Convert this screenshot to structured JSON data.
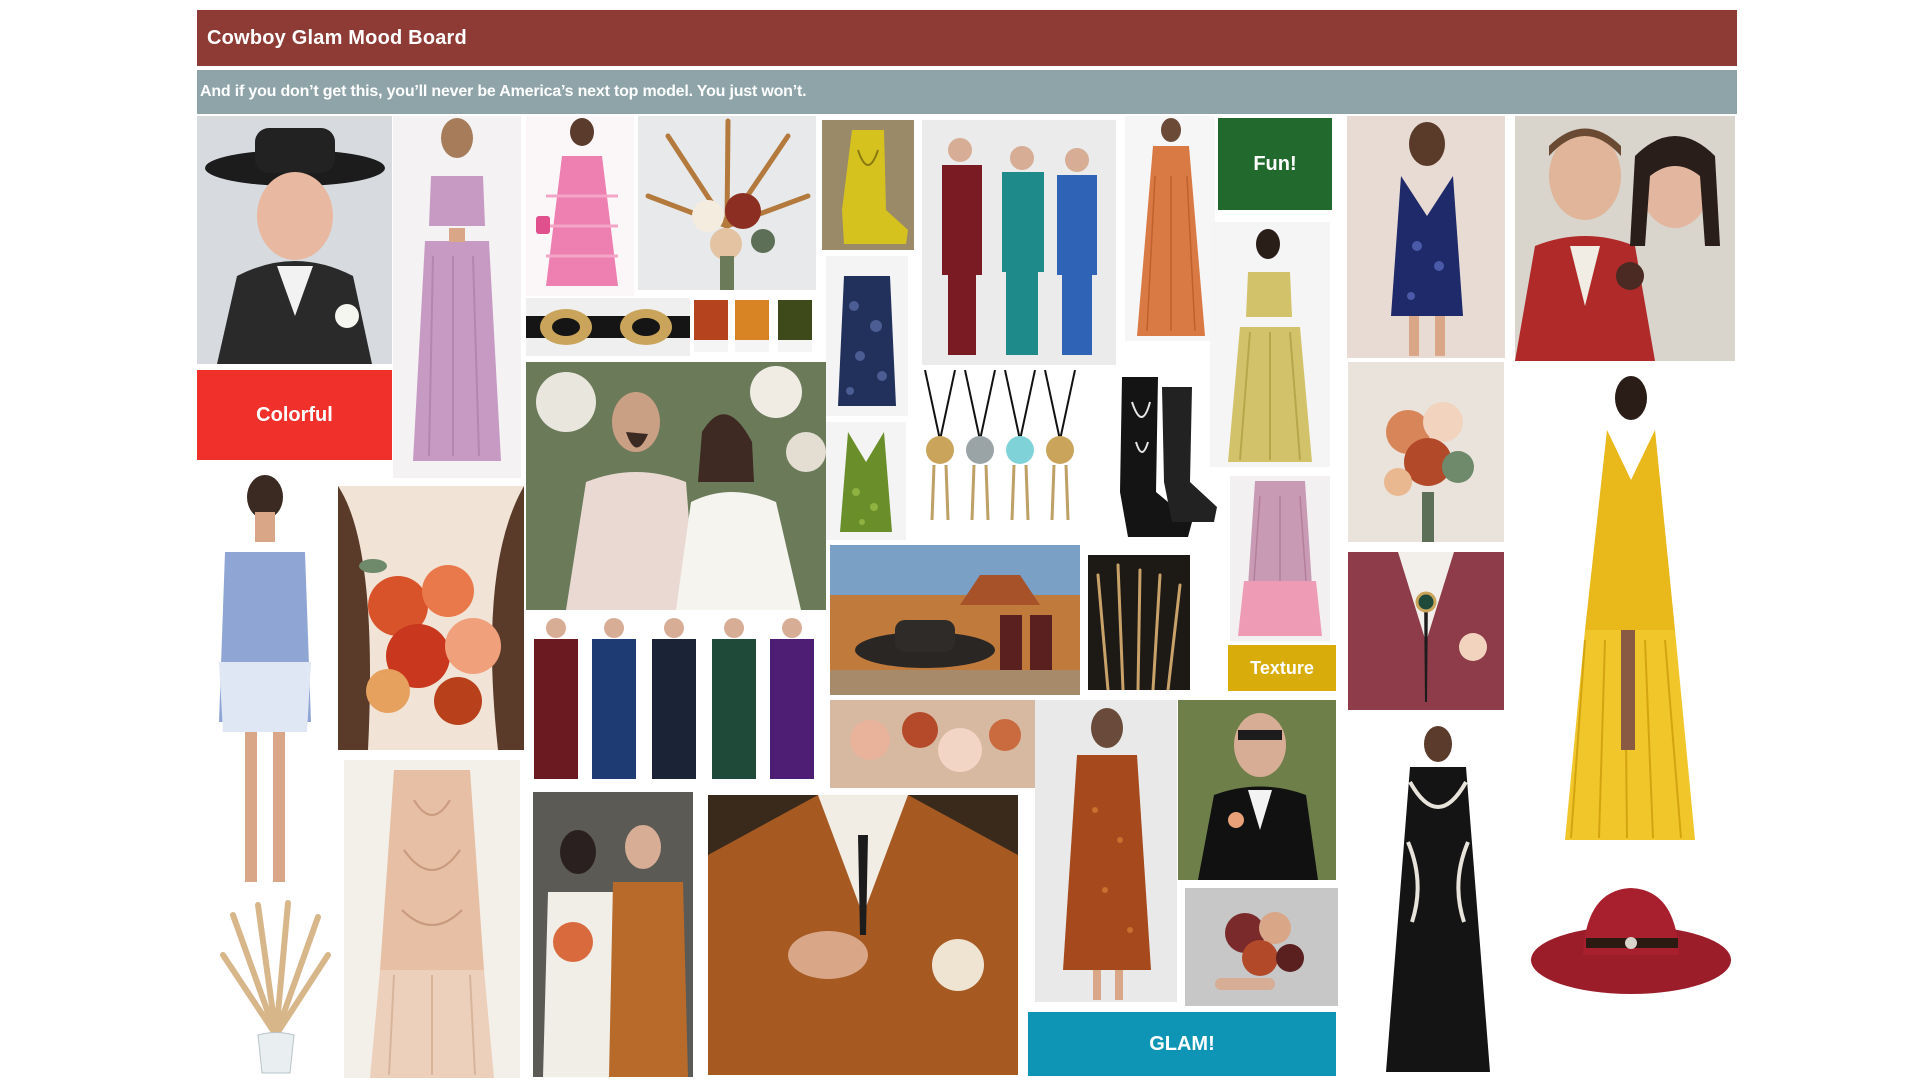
{
  "header": {
    "title": "Cowboy Glam Mood Board",
    "subtitle": "And if you don’t get this, you’ll never be America’s next top model. You just won’t."
  },
  "labels": {
    "colorful": "Colorful",
    "fun": "Fun!",
    "texture": "Texture",
    "glam": "GLAM!"
  },
  "palette_swatches": [
    "#b5431e",
    "#d98424",
    "#3e4a1a"
  ],
  "label_colors": {
    "colorful": "#f0302a",
    "fun": "#22692d",
    "texture": "#d8ad0b",
    "glam": "#0e95b5"
  }
}
